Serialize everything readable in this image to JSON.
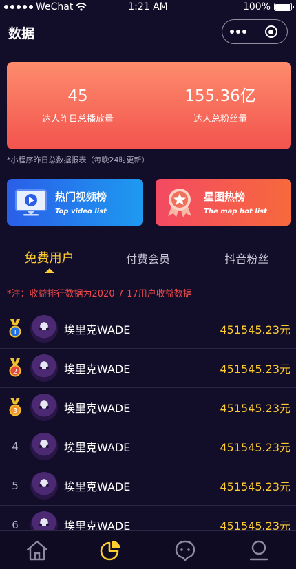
{
  "status_bar": {
    "carrier": "WeChat",
    "time": "1:21 AM",
    "battery": "100%"
  },
  "nav": {
    "title": "数据"
  },
  "summary": {
    "left_value": "45",
    "left_label": "达人昨日总播放量",
    "right_value": "155.36亿",
    "right_label": "达人总粉丝量"
  },
  "summary_note": "*小程序昨日总数据报表（每晚24时更新）",
  "banners": [
    {
      "title": "热门视频榜",
      "subtitle": "Top video list",
      "icon": "video-play-icon"
    },
    {
      "title": "星图热榜",
      "subtitle": "The map hot list",
      "icon": "star-badge-icon"
    }
  ],
  "tabs": [
    {
      "label": "免费用户",
      "active": true
    },
    {
      "label": "付费会员",
      "active": false
    },
    {
      "label": "抖音粉丝",
      "active": false
    }
  ],
  "notice": "*注：收益排行数据为2020-7-17用户收益数据",
  "ranking": [
    {
      "rank": "1",
      "medal": "gold",
      "medal_color": "#1f6fe6",
      "name": "埃里克WADE",
      "amount": "451545.23元"
    },
    {
      "rank": "2",
      "medal": "silver",
      "medal_color": "#e4473b",
      "name": "埃里克WADE",
      "amount": "451545.23元"
    },
    {
      "rank": "3",
      "medal": "bronze",
      "medal_color": "#f2902a",
      "name": "埃里克WADE",
      "amount": "451545.23元"
    },
    {
      "rank": "4",
      "medal": "",
      "name": "埃里克WADE",
      "amount": "451545.23元"
    },
    {
      "rank": "5",
      "medal": "",
      "name": "埃里克WADE",
      "amount": "451545.23元"
    },
    {
      "rank": "6",
      "medal": "",
      "name": "埃里克WADE",
      "amount": "451545.23元"
    }
  ],
  "tabbar": [
    {
      "icon": "home-icon",
      "active": false
    },
    {
      "icon": "pie-chart-icon",
      "active": true
    },
    {
      "icon": "chat-icon",
      "active": false
    },
    {
      "icon": "user-icon",
      "active": false
    }
  ],
  "colors": {
    "background": "#120d29",
    "accent": "#ffcd2e",
    "notice": "#f04a4a"
  }
}
